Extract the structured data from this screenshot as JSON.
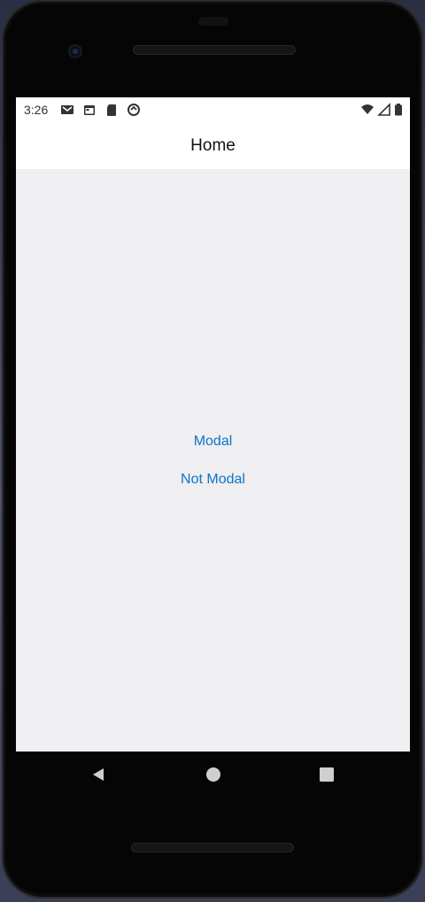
{
  "status_bar": {
    "time": "3:26",
    "left_icons": [
      "gmail-icon",
      "calendar-icon",
      "sd-card-icon",
      "sync-icon"
    ],
    "right_icons": [
      "wifi-icon",
      "cell-signal-icon",
      "battery-icon"
    ]
  },
  "header": {
    "title": "Home"
  },
  "main": {
    "links": [
      {
        "label": "Modal"
      },
      {
        "label": "Not Modal"
      }
    ],
    "link_color": "#0b75c9",
    "background": "#efeef1"
  },
  "system_nav": {
    "buttons": [
      "back-icon",
      "home-icon",
      "recents-icon"
    ]
  }
}
